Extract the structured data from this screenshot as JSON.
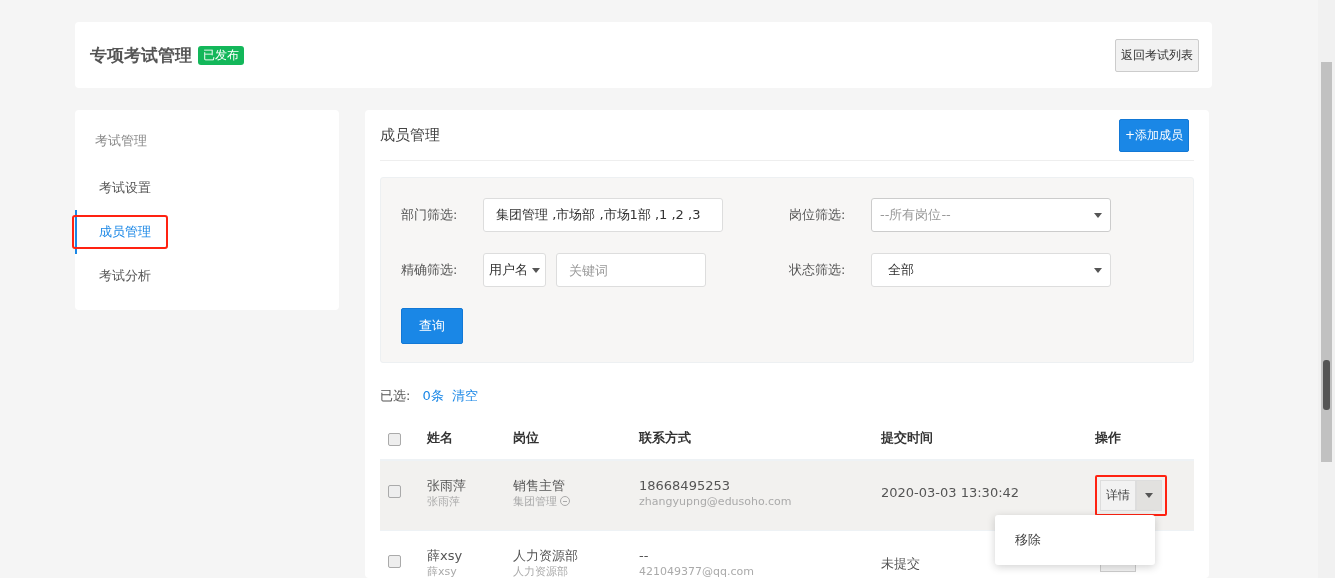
{
  "header": {
    "title": "专项考试管理",
    "badge": "已发布",
    "back_button": "返回考试列表"
  },
  "sidebar": {
    "heading": "考试管理",
    "items": [
      {
        "label": "考试设置",
        "selected": false,
        "highlighted": false
      },
      {
        "label": "成员管理",
        "selected": true,
        "highlighted": true
      },
      {
        "label": "考试分析",
        "selected": false,
        "highlighted": false
      }
    ]
  },
  "panel": {
    "title": "成员管理",
    "add_button": "+添加成员"
  },
  "filters": {
    "department": {
      "label": "部门筛选:",
      "value": "集团管理 ,市场部 ,市场1部 ,1 ,2 ,3"
    },
    "position": {
      "label": "岗位筛选:",
      "placeholder": "--所有岗位--"
    },
    "exact": {
      "label": "精确筛选:",
      "field_type": "用户名",
      "placeholder": "关键词"
    },
    "status": {
      "label": "状态筛选:",
      "value": "全部"
    },
    "query_button": "查询"
  },
  "selection": {
    "label": "已选:",
    "count": "0条",
    "clear": "清空"
  },
  "table": {
    "select_all_checked": false,
    "columns": [
      "姓名",
      "岗位",
      "联系方式",
      "提交时间",
      "操作"
    ],
    "rows": [
      {
        "checked": false,
        "name": "张雨萍",
        "username": "张雨萍",
        "position": "销售主管",
        "department": "集团管理",
        "phone": "18668495253",
        "email": "zhangyupng@edusoho.com",
        "submitted": "2020-03-03 13:30:42",
        "action": "详情",
        "highlighted": true,
        "hovered": true
      },
      {
        "checked": false,
        "name": "薛xsy",
        "username": "薛xsy",
        "position": "人力资源部",
        "department": "人力资源部",
        "phone": "--",
        "email": "421049377@qq.com",
        "submitted": "未提交",
        "highlighted": false,
        "hovered": false
      }
    ]
  },
  "dropdown_menu": {
    "items": [
      "移除"
    ]
  }
}
